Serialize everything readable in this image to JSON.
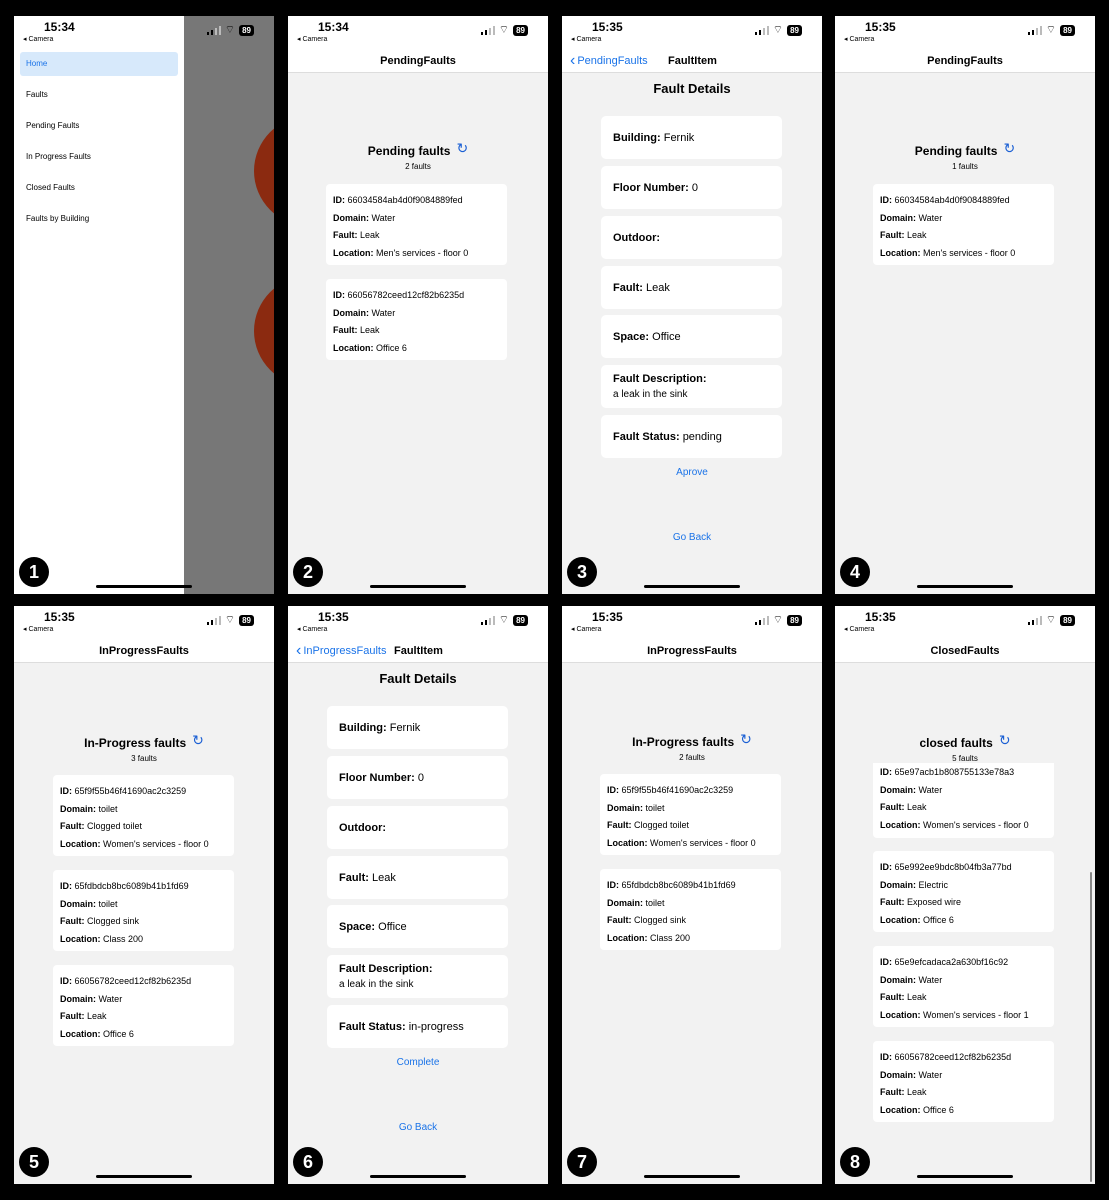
{
  "status": {
    "signal_icon": "signal-bars-icon",
    "wifi_icon": "wifi-icon",
    "battery_label": "89",
    "back_app_label": "◂ Camera"
  },
  "screens": {
    "s1": {
      "badge": "1",
      "time": "15:34",
      "menu": [
        "Home",
        "Faults",
        "Pending Faults",
        "In Progress Faults",
        "Closed Faults",
        "Faults by Building"
      ]
    },
    "s2": {
      "badge": "2",
      "time": "15:34",
      "nav_title": "PendingFaults",
      "heading": "Pending faults",
      "count": "2 faults",
      "cards": [
        {
          "id": "66034584ab4d0f9084889fed",
          "domain": "Water",
          "fault": "Leak",
          "location": "Men's services - floor 0"
        },
        {
          "id": "66056782ceed12cf82b6235d",
          "domain": "Water",
          "fault": "Leak",
          "location": "Office 6"
        }
      ]
    },
    "s3": {
      "badge": "3",
      "time": "15:35",
      "back_label": "PendingFaults",
      "nav_title": "FaultItem",
      "title": "Fault Details",
      "building": "Fernik",
      "floor": "0",
      "outdoor": "",
      "fault": "Leak",
      "space": "Office",
      "description": "a leak in the sink",
      "status": "pending",
      "action": "Aprove",
      "go_back": "Go Back"
    },
    "s4": {
      "badge": "4",
      "time": "15:35",
      "nav_title": "PendingFaults",
      "heading": "Pending faults",
      "count": "1 faults",
      "cards": [
        {
          "id": "66034584ab4d0f9084889fed",
          "domain": "Water",
          "fault": "Leak",
          "location": "Men's services - floor 0"
        }
      ]
    },
    "s5": {
      "badge": "5",
      "time": "15:35",
      "nav_title": "InProgressFaults",
      "heading": "In-Progress faults",
      "count": "3 faults",
      "cards": [
        {
          "id": "65f9f55b46f41690ac2c3259",
          "domain": "toilet",
          "fault": "Clogged toilet",
          "location": "Women's services - floor 0"
        },
        {
          "id": "65fdbdcb8bc6089b41b1fd69",
          "domain": "toilet",
          "fault": "Clogged sink",
          "location": "Class 200"
        },
        {
          "id": "66056782ceed12cf82b6235d",
          "domain": "Water",
          "fault": "Leak",
          "location": "Office 6"
        }
      ]
    },
    "s6": {
      "badge": "6",
      "time": "15:35",
      "back_label": "InProgressFaults",
      "nav_title": "FaultItem",
      "title": "Fault Details",
      "building": "Fernik",
      "floor": "0",
      "outdoor": "",
      "fault": "Leak",
      "space": "Office",
      "description": "a leak in the sink",
      "status": "in-progress",
      "action": "Complete",
      "go_back": "Go Back"
    },
    "s7": {
      "badge": "7",
      "time": "15:35",
      "nav_title": "InProgressFaults",
      "heading": "In-Progress faults",
      "count": "2 faults",
      "cards": [
        {
          "id": "65f9f55b46f41690ac2c3259",
          "domain": "toilet",
          "fault": "Clogged toilet",
          "location": "Women's services - floor 0"
        },
        {
          "id": "65fdbdcb8bc6089b41b1fd69",
          "domain": "toilet",
          "fault": "Clogged sink",
          "location": "Class 200"
        }
      ]
    },
    "s8": {
      "badge": "8",
      "time": "15:35",
      "nav_title": "ClosedFaults",
      "heading": "closed faults",
      "count": "5 faults",
      "cards": [
        {
          "id": "65e97acb1b808755133e78a3",
          "domain": "Water",
          "fault": "Leak",
          "location": "Women's services - floor 0"
        },
        {
          "id": "65e992ee9bdc8b04fb3a77bd",
          "domain": "Electric",
          "fault": "Exposed wire",
          "location": "Office 6"
        },
        {
          "id": "65e9efcadaca2a630bf16c92",
          "domain": "Water",
          "fault": "Leak",
          "location": "Women's services - floor 1"
        },
        {
          "id": "66056782ceed12cf82b6235d",
          "domain": "Water",
          "fault": "Leak",
          "location": "Office 6"
        }
      ]
    }
  },
  "labels": {
    "id": "ID:",
    "domain": "Domain:",
    "fault": "Fault:",
    "location": "Location:",
    "building": "Building:",
    "floor": "Floor Number:",
    "outdoor": "Outdoor:",
    "space": "Space:",
    "description": "Fault Description:",
    "status": "Fault Status:"
  }
}
